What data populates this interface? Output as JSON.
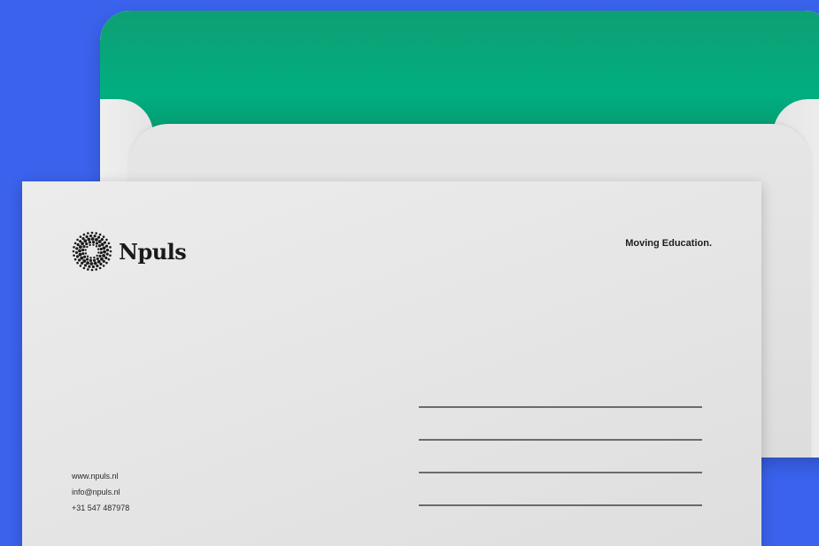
{
  "brand": {
    "name": "Npuls",
    "tagline": "Moving Education."
  },
  "contact": {
    "website": "www.npuls.nl",
    "email": "info@npuls.nl",
    "phone": "+31 547 487978"
  },
  "address_lines": [
    {
      "label": ""
    },
    {
      "label": ""
    },
    {
      "label": ""
    },
    {
      "label": ""
    }
  ],
  "colors": {
    "background": "#3a62ec",
    "lining": "#00ae7f",
    "paper": "#e6e6e6",
    "ink": "#1a1a1a"
  },
  "icons": {
    "logo": "dotted-circle-logo-icon"
  }
}
